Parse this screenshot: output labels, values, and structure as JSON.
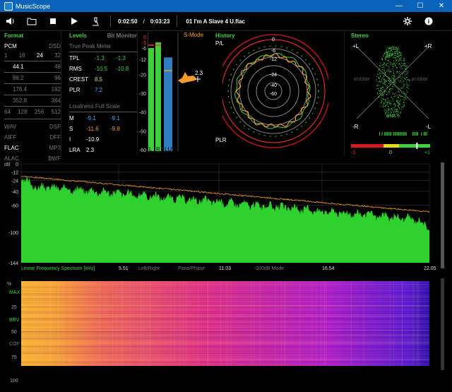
{
  "window": {
    "title": "MusicScope",
    "minimize": "—",
    "maximize": "☐",
    "close": "✕"
  },
  "toolbar": {
    "elapsed": "0:02:50",
    "slash": "/",
    "total": "0:03:23",
    "track": "01 I'm A Slave 4 U.flac"
  },
  "icons": {
    "speaker": "🔊",
    "folder": "📁",
    "stop": "■",
    "play": "▶",
    "microscope": "🔬",
    "settings": "✹",
    "info": "i"
  },
  "format": {
    "title": "Format",
    "pcm": "PCM",
    "dsd": "DSD",
    "rates_row": [
      "1",
      "16",
      "24",
      "32"
    ],
    "rows": [
      [
        "44.1",
        "48"
      ],
      [
        "88.2",
        "96"
      ],
      [
        "176.4",
        "192"
      ],
      [
        "352.8",
        "384"
      ]
    ],
    "dsd_row": [
      "64",
      "128",
      "256",
      "512"
    ],
    "codecs": [
      [
        "WAV",
        "DSF"
      ],
      [
        "AIFF",
        "DFF"
      ],
      [
        "FLAC",
        "MP3"
      ],
      [
        "ALAC",
        "BWF"
      ]
    ]
  },
  "levels": {
    "title": "Levels",
    "bitmonitor": "Bit Monitor",
    "tpm": "True Peak Meter",
    "rows": [
      {
        "label": "TPL",
        "l": "-1.3",
        "r": "-1.3"
      },
      {
        "label": "RMS",
        "l": "-10.5",
        "r": "-10.8"
      },
      {
        "label": "CREST",
        "l": "8.5",
        "r": ""
      },
      {
        "label": "PLR",
        "l": "7.2",
        "r": ""
      }
    ],
    "lfs": "Loudness Full Scale",
    "loud": [
      {
        "label": "M",
        "a": "-9.1",
        "b": "-9.1"
      },
      {
        "label": "S",
        "a": "-11.6",
        "b": "-9.8"
      },
      {
        "label": "I",
        "a": "-10.9",
        "b": ""
      },
      {
        "label": "LRA",
        "a": "2.3",
        "b": ""
      }
    ]
  },
  "meter": {
    "smode": "S-Mode",
    "scale": [
      "0",
      "-3",
      "-6",
      "-12",
      "-20",
      "-30",
      "-40",
      "-50",
      "-60"
    ],
    "l": "L",
    "r": "R",
    "lu": "LU",
    "peak_label": "2.3",
    "l_level": -6,
    "r_level": -3,
    "lu_level": -11
  },
  "history": {
    "title": "History",
    "pl": "P/L",
    "plr": "PLR",
    "rings": [
      "-6",
      "-12",
      "-24",
      "-40",
      "-60"
    ],
    "zero": "0"
  },
  "stereo": {
    "title": "Stereo",
    "tl": "+L",
    "tr": "+R",
    "bl": "-R",
    "br": "-L",
    "oop": "out of phase",
    "m1": "-1",
    "m0": "0",
    "p1": "+1",
    "correlation": 0.65
  },
  "spectrum": {
    "db": "dB",
    "yticks": [
      "0",
      "-12",
      "-24",
      "-40",
      "-60",
      "-100",
      "-144"
    ],
    "xlabels": [
      "Linear Frequency Spectrum [kHz]",
      "5.51",
      "Left/Right",
      "Pano/Phase",
      "11.03",
      "-200dB Mode",
      "16.54",
      "22.05"
    ]
  },
  "spectrogram": {
    "yticks": [
      "%",
      "25",
      "50",
      "75",
      "100"
    ],
    "labels": [
      "MAX",
      "BRV",
      "COF"
    ]
  }
}
